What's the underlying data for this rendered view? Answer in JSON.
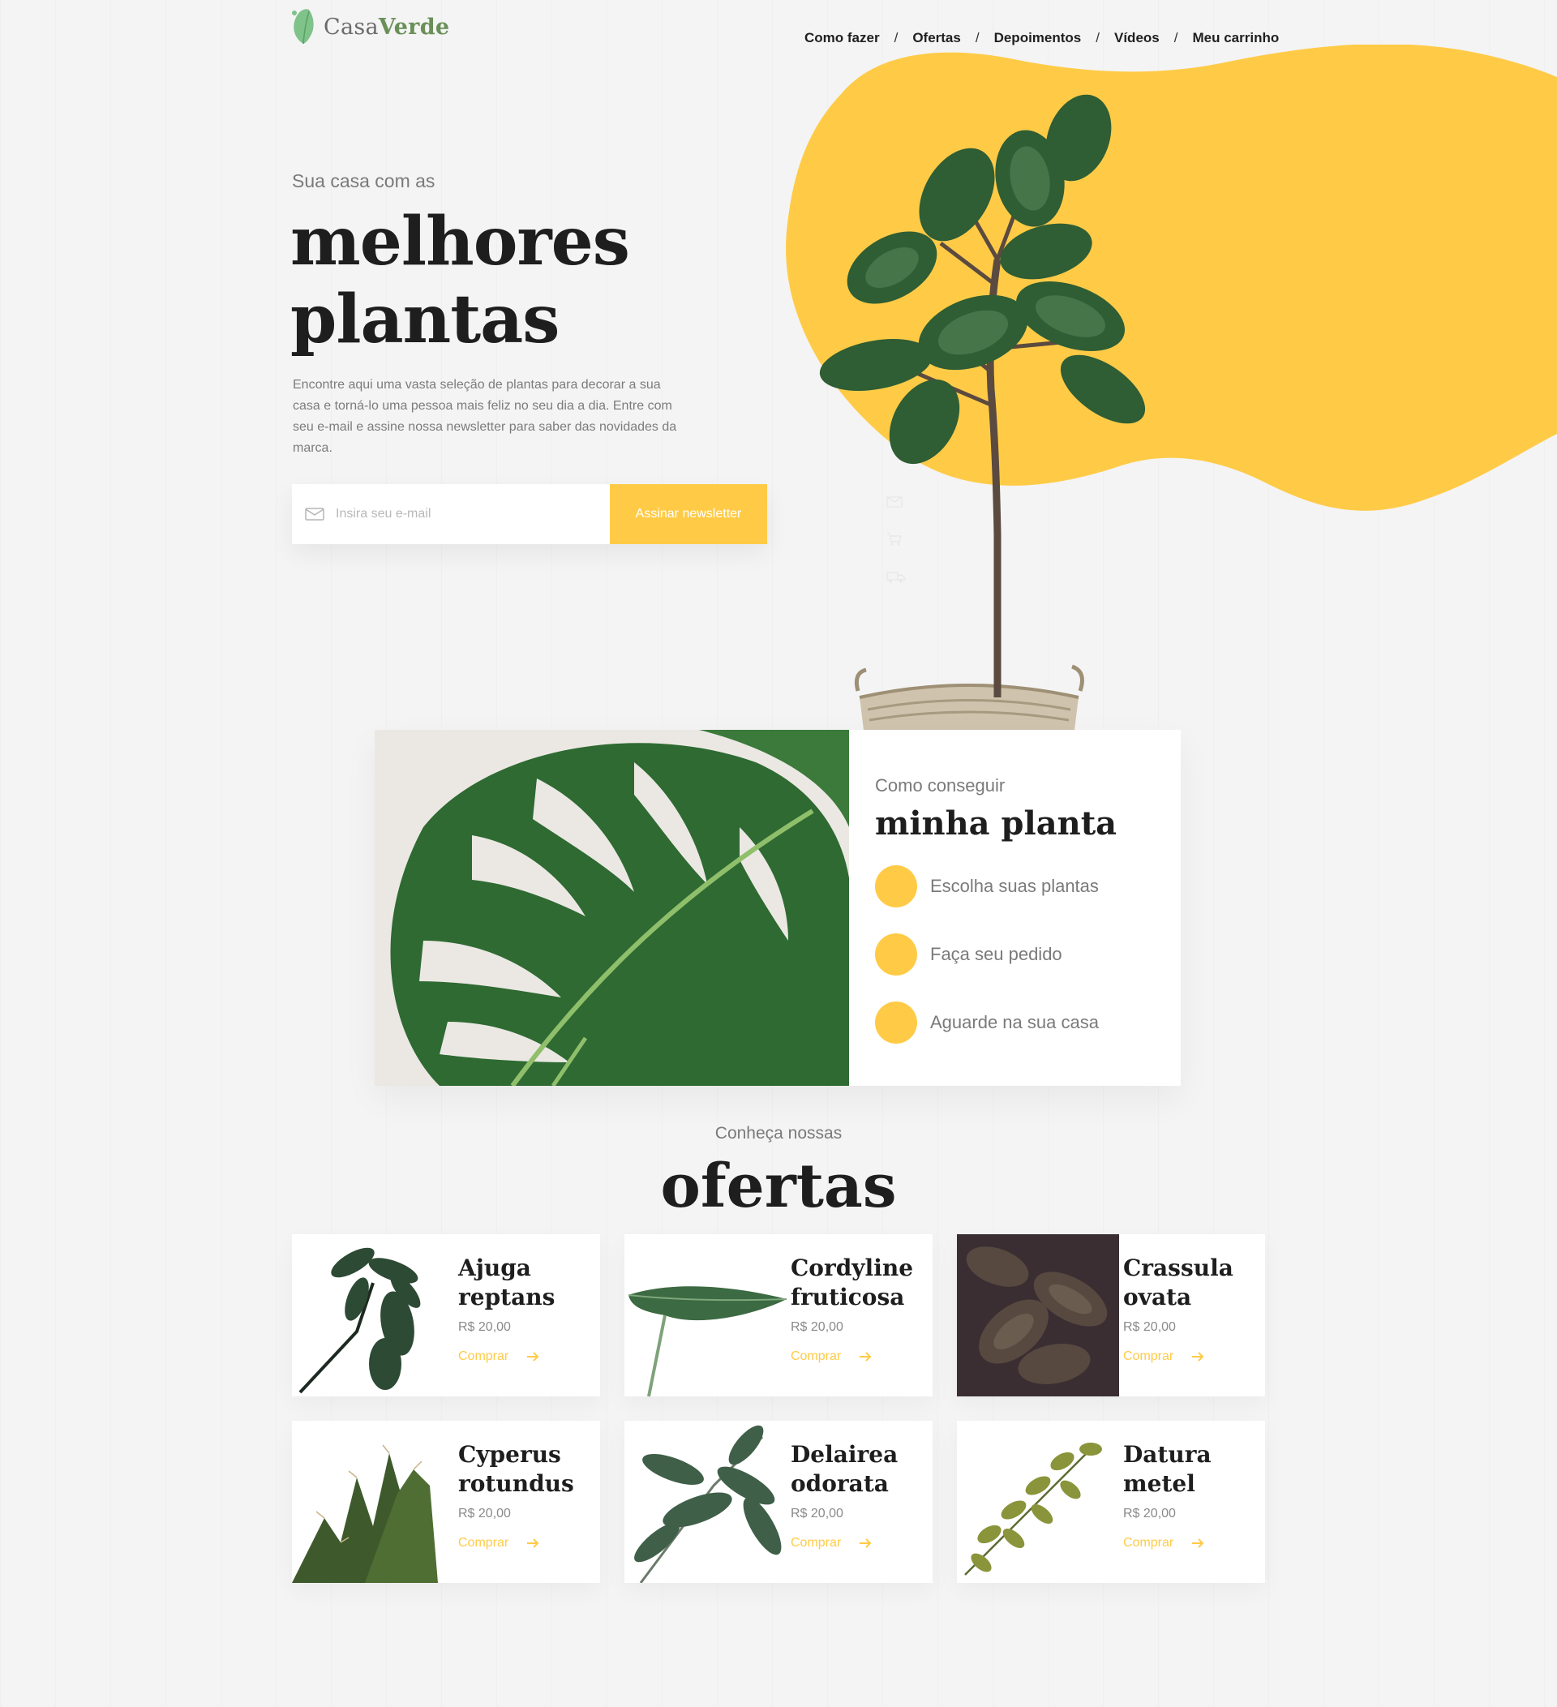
{
  "brand": {
    "name_light": "Casa",
    "name_bold": "Verde"
  },
  "nav": {
    "items": [
      "Como fazer",
      "Ofertas",
      "Depoimentos",
      "Vídeos",
      "Meu carrinho"
    ],
    "separator": "/"
  },
  "hero": {
    "subtitle": "Sua casa com as",
    "title_line1": "melhores",
    "title_line2": "plantas",
    "description": "Encontre aqui uma vasta seleção de plantas para decorar a sua casa e torná-lo uma pessoa mais feliz no seu dia a dia. Entre com seu e-mail e assine nossa newsletter para saber das novidades da marca.",
    "email_placeholder": "Insira seu e-mail",
    "email_value": "",
    "subscribe_label": "Assinar newsletter"
  },
  "how": {
    "subtitle": "Como conseguir",
    "title": "minha planta",
    "steps": [
      "Escolha suas plantas",
      "Faça seu pedido",
      "Aguarde na sua casa"
    ]
  },
  "offers": {
    "subtitle": "Conheça nossas",
    "title": "ofertas",
    "products": [
      {
        "name_line1": "Ajuga",
        "name_line2": "reptans",
        "price": "R$ 20,00",
        "buy_label": "Comprar"
      },
      {
        "name_line1": "Cordyline",
        "name_line2": "fruticosa",
        "price": "R$ 20,00",
        "buy_label": "Comprar"
      },
      {
        "name_line1": "Crassula",
        "name_line2": "ovata",
        "price": "R$ 20,00",
        "buy_label": "Comprar"
      },
      {
        "name_line1": "Cyperus",
        "name_line2": "rotundus",
        "price": "R$ 20,00",
        "buy_label": "Comprar"
      },
      {
        "name_line1": "Delairea",
        "name_line2": "odorata",
        "price": "R$ 20,00",
        "buy_label": "Comprar"
      },
      {
        "name_line1": "Datura",
        "name_line2": "metel",
        "price": "R$ 20,00",
        "buy_label": "Comprar"
      }
    ]
  },
  "colors": {
    "accent": "#ffcb47",
    "leaf": "#2f5d34",
    "text": "#1e1e1e",
    "muted": "#7a7a7a"
  },
  "icons": [
    "leaf-logo-icon",
    "mail-icon",
    "cart-icon",
    "truck-icon",
    "arrow-right-icon"
  ]
}
